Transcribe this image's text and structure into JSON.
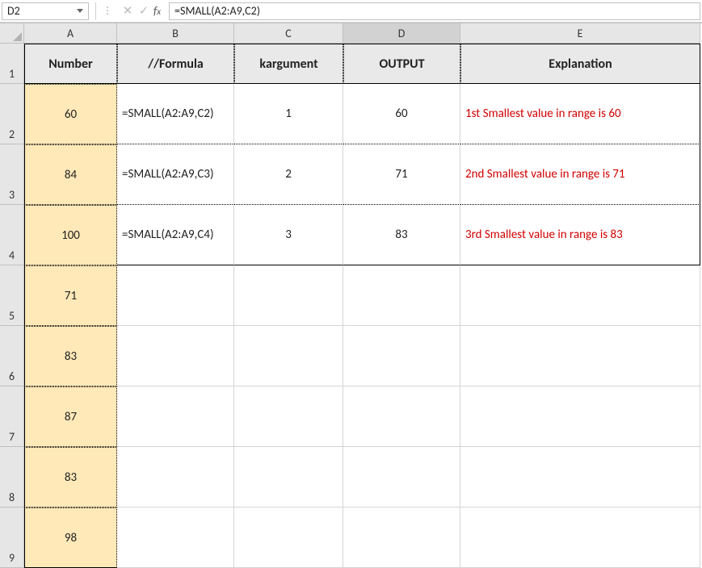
{
  "formulaBar": {
    "activeCell": "D2",
    "formula": "=SMALL(A2:A9,C2)"
  },
  "columnLetters": [
    "A",
    "B",
    "C",
    "D",
    "E"
  ],
  "rowNumbers": [
    "1",
    "2",
    "3",
    "4",
    "5",
    "6",
    "7",
    "8",
    "9"
  ],
  "headers": {
    "A": "Number",
    "B": "//Formula",
    "C_prefix": "k",
    "C_rest": " argument",
    "D": "OUTPUT",
    "E": "Explanation"
  },
  "colA": [
    "60",
    "84",
    "100",
    "71",
    "83",
    "87",
    "83",
    "98"
  ],
  "rows": [
    {
      "B": "=SMALL(A2:A9,C2)",
      "C": "1",
      "D": "60",
      "E": "1st Smallest value in range is 60"
    },
    {
      "B": "=SMALL(A2:A9,C3)",
      "C": "2",
      "D": "71",
      "E": "2nd Smallest value in range is 71"
    },
    {
      "B": "=SMALL(A2:A9,C4)",
      "C": "3",
      "D": "83",
      "E": "3rd Smallest value in range is 83"
    }
  ]
}
